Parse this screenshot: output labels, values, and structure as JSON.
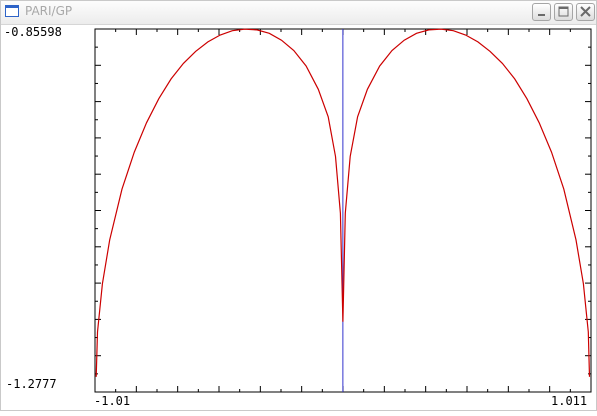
{
  "window": {
    "title": "PARI/GP",
    "icon": "window-icon",
    "buttons": [
      "minimize-icon",
      "maximize-icon",
      "close-icon"
    ]
  },
  "plot": {
    "y_top_label": "-0.85598",
    "y_bottom_label": "-1.2777",
    "x_left_label": "-1.01",
    "x_right_label": "1.011",
    "colors": {
      "frame": "#000000",
      "curve": "#cc0000",
      "axis": "#3333cc"
    }
  },
  "chart_data": {
    "type": "line",
    "title": "",
    "xlabel": "",
    "ylabel": "",
    "xlim": [
      -1.01,
      1.011
    ],
    "ylim": [
      -1.2777,
      -0.85598
    ],
    "grid": false,
    "series": [
      {
        "color": "#cc0000",
        "x": [
          -1.005,
          -1.0,
          -0.98,
          -0.95,
          -0.9,
          -0.85,
          -0.8,
          -0.75,
          -0.7,
          -0.65,
          -0.6,
          -0.55,
          -0.5,
          -0.45,
          -0.4,
          -0.35,
          -0.3,
          -0.25,
          -0.2,
          -0.15,
          -0.1,
          -0.06,
          -0.03,
          -0.01,
          0.0,
          0.01,
          0.03,
          0.06,
          0.1,
          0.15,
          0.2,
          0.25,
          0.3,
          0.35,
          0.4,
          0.45,
          0.5,
          0.55,
          0.6,
          0.65,
          0.7,
          0.75,
          0.8,
          0.85,
          0.9,
          0.95,
          0.98,
          1.0,
          1.005
        ],
        "y": [
          -1.26,
          -1.208,
          -1.152,
          -1.101,
          -1.042,
          -0.999,
          -0.965,
          -0.937,
          -0.914,
          -0.896,
          -0.882,
          -0.871,
          -0.863,
          -0.858,
          -0.8562,
          -0.857,
          -0.861,
          -0.869,
          -0.881,
          -0.899,
          -0.926,
          -0.958,
          -1.004,
          -1.07,
          -1.196,
          -1.07,
          -1.004,
          -0.958,
          -0.926,
          -0.899,
          -0.881,
          -0.869,
          -0.861,
          -0.857,
          -0.8562,
          -0.858,
          -0.863,
          -0.871,
          -0.882,
          -0.896,
          -0.914,
          -0.937,
          -0.965,
          -0.999,
          -1.042,
          -1.101,
          -1.152,
          -1.208,
          -1.26
        ]
      }
    ],
    "axis_line": {
      "x": 0.0,
      "color": "#3333cc"
    }
  }
}
